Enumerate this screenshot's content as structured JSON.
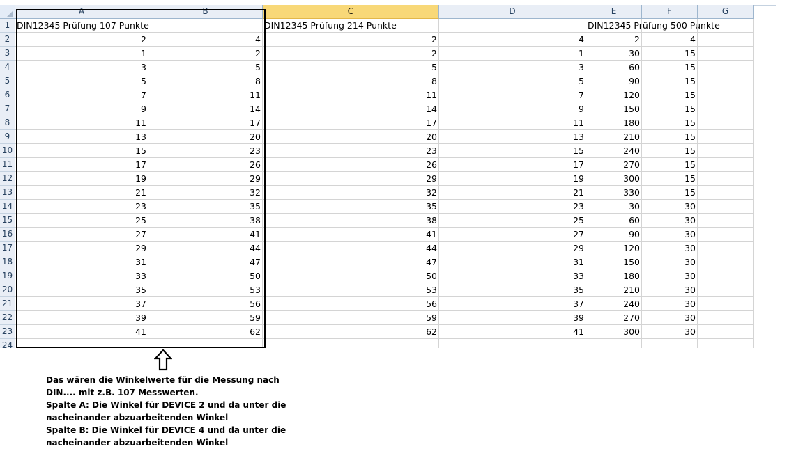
{
  "columns": [
    "A",
    "B",
    "C",
    "D",
    "E",
    "F",
    "G"
  ],
  "selected_column": "C",
  "rows": [
    [
      "DIN12345 Prüfung 107 Punkte",
      "",
      "DIN12345 Prüfung 214 Punkte",
      "",
      "DIN12345 Prüfung 500 Punkte",
      "",
      ""
    ],
    [
      "2",
      "4",
      "2",
      "4",
      "2",
      "4",
      ""
    ],
    [
      "1",
      "2",
      "2",
      "1",
      "30",
      "15",
      ""
    ],
    [
      "3",
      "5",
      "5",
      "3",
      "60",
      "15",
      ""
    ],
    [
      "5",
      "8",
      "8",
      "5",
      "90",
      "15",
      ""
    ],
    [
      "7",
      "11",
      "11",
      "7",
      "120",
      "15",
      ""
    ],
    [
      "9",
      "14",
      "14",
      "9",
      "150",
      "15",
      ""
    ],
    [
      "11",
      "17",
      "17",
      "11",
      "180",
      "15",
      ""
    ],
    [
      "13",
      "20",
      "20",
      "13",
      "210",
      "15",
      ""
    ],
    [
      "15",
      "23",
      "23",
      "15",
      "240",
      "15",
      ""
    ],
    [
      "17",
      "26",
      "26",
      "17",
      "270",
      "15",
      ""
    ],
    [
      "19",
      "29",
      "29",
      "19",
      "300",
      "15",
      ""
    ],
    [
      "21",
      "32",
      "32",
      "21",
      "330",
      "15",
      ""
    ],
    [
      "23",
      "35",
      "35",
      "23",
      "30",
      "30",
      ""
    ],
    [
      "25",
      "38",
      "38",
      "25",
      "60",
      "30",
      ""
    ],
    [
      "27",
      "41",
      "41",
      "27",
      "90",
      "30",
      ""
    ],
    [
      "29",
      "44",
      "44",
      "29",
      "120",
      "30",
      ""
    ],
    [
      "31",
      "47",
      "47",
      "31",
      "150",
      "30",
      ""
    ],
    [
      "33",
      "50",
      "50",
      "33",
      "180",
      "30",
      ""
    ],
    [
      "35",
      "53",
      "53",
      "35",
      "210",
      "30",
      ""
    ],
    [
      "37",
      "56",
      "56",
      "37",
      "240",
      "30",
      ""
    ],
    [
      "39",
      "59",
      "59",
      "39",
      "270",
      "30",
      ""
    ],
    [
      "41",
      "62",
      "62",
      "41",
      "300",
      "30",
      ""
    ],
    [
      "",
      "",
      "",
      "",
      "",
      "",
      ""
    ]
  ],
  "note": {
    "lines": [
      "Das wären die Winkelwerte für die Messung nach",
      "DIN.... mit z.B. 107 Messwerten.",
      "Spalte A: Die Winkel für DEVICE 2 und da unter die",
      "nacheinander abzuarbeitenden Winkel",
      "Spalte B: Die Winkel für DEVICE 4 und da unter die",
      "nacheinander abzuarbeitenden Winkel"
    ]
  },
  "icons": {
    "arrow": "up-arrow-outline-icon"
  }
}
